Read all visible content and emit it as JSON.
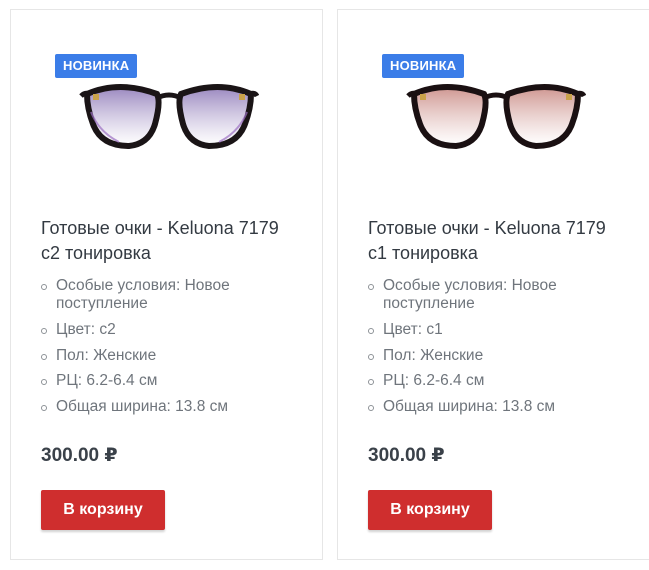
{
  "currency": "₽",
  "products": [
    {
      "badge": "НОВИНКА",
      "title_line1": "Готовые очки - Keluona 7179",
      "title_line2": "c2 тонировка",
      "specs": [
        {
          "line1": "Особые условия: Новое",
          "line2": "поступление"
        },
        {
          "line1": "Цвет: c2"
        },
        {
          "line1": "Пол: Женские"
        },
        {
          "line1": "РЦ: 6.2-6.4 см"
        },
        {
          "line1": "Общая ширина: 13.8 см"
        }
      ],
      "price": "300.00 ₽",
      "cart_label": "В корзину",
      "lens_tint": "#b9a0d8",
      "frame_color": "#1a1416",
      "image_icon": "cat-eye-glasses-icon"
    },
    {
      "badge": "НОВИНКА",
      "title_line1": "Готовые очки - Keluona 7179",
      "title_line2": "c1 тонировка",
      "specs": [
        {
          "line1": "Особые условия: Новое",
          "line2": "поступление"
        },
        {
          "line1": "Цвет: c1"
        },
        {
          "line1": "Пол: Женские"
        },
        {
          "line1": "РЦ: 6.2-6.4 см"
        },
        {
          "line1": "Общая ширина: 13.8 см"
        }
      ],
      "price": "300.00 ₽",
      "cart_label": "В корзину",
      "lens_tint": "#e6b0a8",
      "frame_color": "#1a1012",
      "image_icon": "cat-eye-glasses-icon"
    }
  ],
  "colors": {
    "badge_bg": "#3b7de8",
    "button_bg": "#cf2e2e",
    "title_text": "#333a42",
    "spec_text": "#6f757c"
  }
}
